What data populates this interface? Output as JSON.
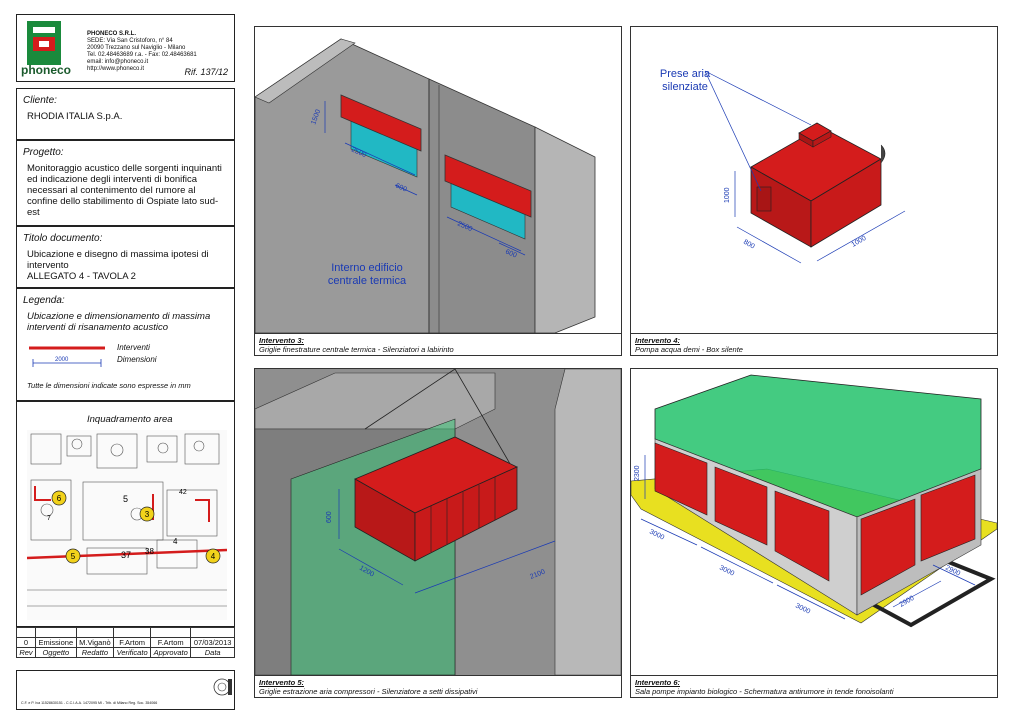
{
  "company": {
    "logo_text": "phoneco",
    "name": "PHONECO S.R.L.",
    "lines": [
      "SEDE: Via San Cristoforo, n° 84",
      "20090 Trezzano sul Naviglio - Milano",
      "Tel. 02.48463689 r.a. - Fax: 02.48463681",
      "email: info@phoneco.it",
      "http://www.phoneco.it"
    ],
    "ref": "Rif. 137/12"
  },
  "client": {
    "label": "Cliente:",
    "value": "RHODIA ITALIA S.p.A."
  },
  "project": {
    "label": "Progetto:",
    "value": "Monitoraggio acustico delle sorgenti inquinanti ed indicazione degli interventi di bonifica necessari al contenimento del rumore al confine dello stabilimento di Ospiate lato sud-est"
  },
  "document": {
    "label": "Titolo documento:",
    "line1": "Ubicazione e disegno di massima ipotesi di intervento",
    "line2": "ALLEGATO 4 - TAVOLA 2"
  },
  "legend": {
    "label": "Legenda:",
    "desc": "Ubicazione e dimensionamento di massima interventi di risanamento acustico",
    "interventi": "Interventi",
    "dimensioni": "Dimensioni",
    "dim_value": "2000",
    "note": "Tutte le dimensioni indicate sono espresse in mm"
  },
  "area": {
    "title": "Inquadramento area",
    "markers": [
      "6",
      "3",
      "5",
      "4"
    ],
    "labels": [
      "5",
      "37",
      "38",
      "4",
      "42",
      "7"
    ]
  },
  "revision": {
    "row": [
      "0",
      "Emissione",
      "M.Viganò",
      "F.Artom",
      "F.Artom",
      "07/03/2013"
    ],
    "headers": [
      "Rev",
      "Oggetto",
      "Redatto",
      "Verificato",
      "Approvato",
      "Data"
    ]
  },
  "footer": "C.F. e P. Iva 11528630151 - C.C.I.A.A. 1472095 MI - Trib. di Milano Reg. Soc. 354066",
  "panels": {
    "p3": {
      "title": "Intervento 3:",
      "desc": "Griglie finestrature centrale termica - Silenziatori a labirinto",
      "note1": "Interno edificio",
      "note2": "centrale termica",
      "dims": [
        "1500",
        "2500",
        "600",
        "2500",
        "600"
      ]
    },
    "p4": {
      "title": "Intervento 4:",
      "desc": "Pompa acqua demi - Box silente",
      "note1": "Prese aria",
      "note2": "silenziate",
      "dims": [
        "1000",
        "800",
        "1000"
      ]
    },
    "p5": {
      "title": "Intervento 5:",
      "desc": "Griglie estrazione aria compressori - Silenziatore a setti dissipativi",
      "dims": [
        "600",
        "1200",
        "2100"
      ]
    },
    "p6": {
      "title": "Intervento 6:",
      "desc": "Sala pompe impianto biologico - Schermatura antirumore in tende fonoisolanti",
      "dims": [
        "2300",
        "3000",
        "3000",
        "3000",
        "2900",
        "2900"
      ]
    }
  }
}
